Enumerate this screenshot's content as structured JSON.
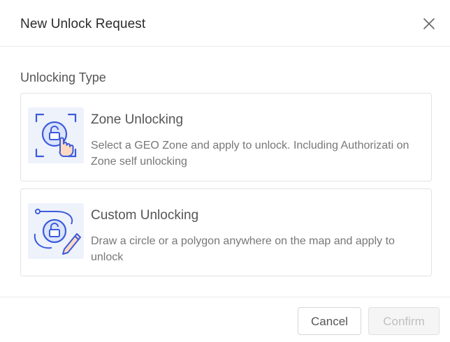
{
  "dialog": {
    "title": "New Unlock Request",
    "close_icon": "close-icon"
  },
  "section": {
    "label": "Unlocking Type"
  },
  "options": [
    {
      "title": "Zone Unlocking",
      "description": "Select a GEO Zone and apply to unlock. Including Authorizati on Zone self unlocking",
      "icon": "zone-unlock-icon"
    },
    {
      "title": "Custom Unlocking",
      "description": "Draw a circle or a polygon anywhere on the map and apply to unlock",
      "icon": "custom-unlock-icon"
    }
  ],
  "footer": {
    "cancel_label": "Cancel",
    "confirm_label": "Confirm"
  },
  "colors": {
    "icon_accent": "#3b5bdb",
    "icon_bg": "#eef2fb",
    "border": "#e3e3e3"
  }
}
